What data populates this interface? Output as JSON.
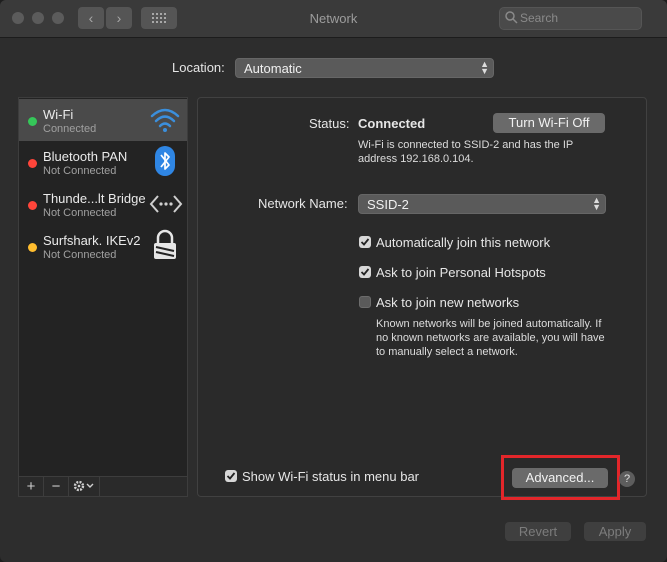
{
  "window": {
    "title": "Network"
  },
  "toolbar": {
    "back_glyph": "‹",
    "forward_glyph": "›",
    "search_placeholder": "Search"
  },
  "location": {
    "label": "Location:",
    "value": "Automatic"
  },
  "services": [
    {
      "name": "Wi-Fi",
      "status": "Connected",
      "status_color": "#35c759",
      "icon": "wifi-icon"
    },
    {
      "name": "Bluetooth PAN",
      "status": "Not Connected",
      "status_color": "#ff453a",
      "icon": "bluetooth-icon"
    },
    {
      "name": "Thunde...lt Bridge",
      "status": "Not Connected",
      "status_color": "#ff453a",
      "icon": "thunderbolt-bridge-icon"
    },
    {
      "name": "Surfshark. IKEv2",
      "status": "Not Connected",
      "status_color": "#ffbd2e",
      "icon": "vpn-lock-icon"
    }
  ],
  "sidebar_controls": {
    "add": "+",
    "remove": "−"
  },
  "detail": {
    "status_label": "Status:",
    "status_value": "Connected",
    "turn_off_button": "Turn Wi-Fi Off",
    "status_desc_1": "Wi-Fi is connected to SSID-2 and has the IP",
    "status_desc_2": "address 192.168.0.104.",
    "network_name_label": "Network Name:",
    "network_name_value": "SSID-2",
    "auto_join": {
      "label": "Automatically join this network",
      "checked": true
    },
    "ask_hotspots": {
      "label": "Ask to join Personal Hotspots",
      "checked": true
    },
    "ask_new": {
      "label": "Ask to join new networks",
      "checked": false
    },
    "known_desc_1": "Known networks will be joined automatically. If",
    "known_desc_2": "no known networks are available, you will have",
    "known_desc_3": "to manually select a network.",
    "show_status": {
      "label": "Show Wi-Fi status in menu bar",
      "checked": true
    },
    "advanced_button": "Advanced...",
    "help_glyph": "?"
  },
  "footer": {
    "revert_button": "Revert",
    "apply_button": "Apply"
  },
  "colors": {
    "highlight": "#e3262a",
    "wifi_accent": "#3b8fdc"
  }
}
